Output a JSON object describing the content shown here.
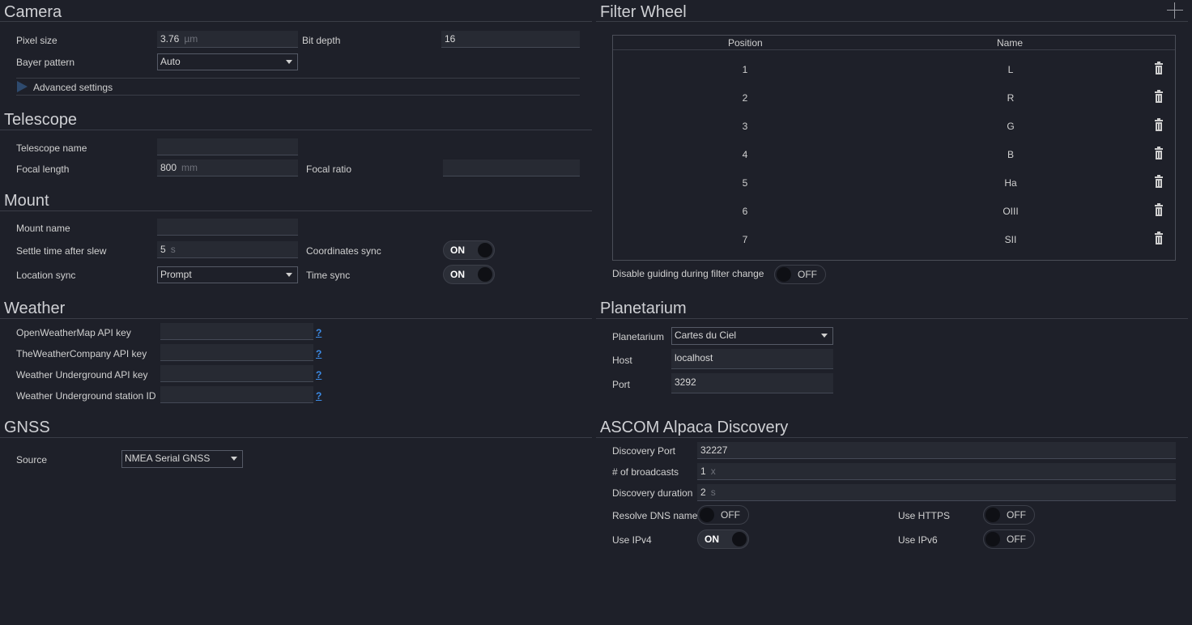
{
  "camera": {
    "title": "Camera",
    "pixel_size_label": "Pixel size",
    "pixel_size_value": "3.76",
    "pixel_size_unit": "µm",
    "bit_depth_label": "Bit depth",
    "bit_depth_value": "16",
    "bayer_label": "Bayer pattern",
    "bayer_value": "Auto",
    "advanced_label": "Advanced settings"
  },
  "telescope": {
    "title": "Telescope",
    "name_label": "Telescope name",
    "name_value": "",
    "focal_length_label": "Focal length",
    "focal_length_value": "800",
    "focal_length_unit": "mm",
    "focal_ratio_label": "Focal ratio",
    "focal_ratio_value": ""
  },
  "mount": {
    "title": "Mount",
    "name_label": "Mount name",
    "name_value": "",
    "settle_label": "Settle time after slew",
    "settle_value": "5",
    "settle_unit": "s",
    "coord_sync_label": "Coordinates sync",
    "coord_sync_state": "ON",
    "location_sync_label": "Location sync",
    "location_sync_value": "Prompt",
    "time_sync_label": "Time sync",
    "time_sync_state": "ON"
  },
  "weather": {
    "title": "Weather",
    "owm_label": "OpenWeatherMap API key",
    "twc_label": "TheWeatherCompany API key",
    "wu_label": "Weather Underground API key",
    "wu_station_label": "Weather Underground station ID",
    "help": "?"
  },
  "gnss": {
    "title": "GNSS",
    "source_label": "Source",
    "source_value": "NMEA Serial GNSS"
  },
  "filter_wheel": {
    "title": "Filter Wheel",
    "col_position": "Position",
    "col_name": "Name",
    "rows": [
      {
        "position": "1",
        "name": "L"
      },
      {
        "position": "2",
        "name": "R"
      },
      {
        "position": "3",
        "name": "G"
      },
      {
        "position": "4",
        "name": "B"
      },
      {
        "position": "5",
        "name": "Ha"
      },
      {
        "position": "6",
        "name": "OIII"
      },
      {
        "position": "7",
        "name": "SII"
      }
    ],
    "disable_guiding_label": "Disable guiding during filter change",
    "disable_guiding_state": "OFF"
  },
  "planetarium": {
    "title": "Planetarium",
    "planetarium_label": "Planetarium",
    "planetarium_value": "Cartes du Ciel",
    "host_label": "Host",
    "host_value": "localhost",
    "port_label": "Port",
    "port_value": "3292"
  },
  "alpaca": {
    "title": "ASCOM Alpaca Discovery",
    "discovery_port_label": "Discovery Port",
    "discovery_port_value": "32227",
    "broadcasts_label": "# of broadcasts",
    "broadcasts_value": "1",
    "broadcasts_unit": "x",
    "duration_label": "Discovery duration",
    "duration_value": "2",
    "duration_unit": "s",
    "resolve_dns_label": "Resolve DNS name",
    "resolve_dns_state": "OFF",
    "use_https_label": "Use HTTPS",
    "use_https_state": "OFF",
    "use_ipv4_label": "Use IPv4",
    "use_ipv4_state": "ON",
    "use_ipv6_label": "Use IPv6",
    "use_ipv6_state": "OFF"
  },
  "colors": {
    "background": "#1e2029",
    "accent_link": "#3c8ce7"
  }
}
